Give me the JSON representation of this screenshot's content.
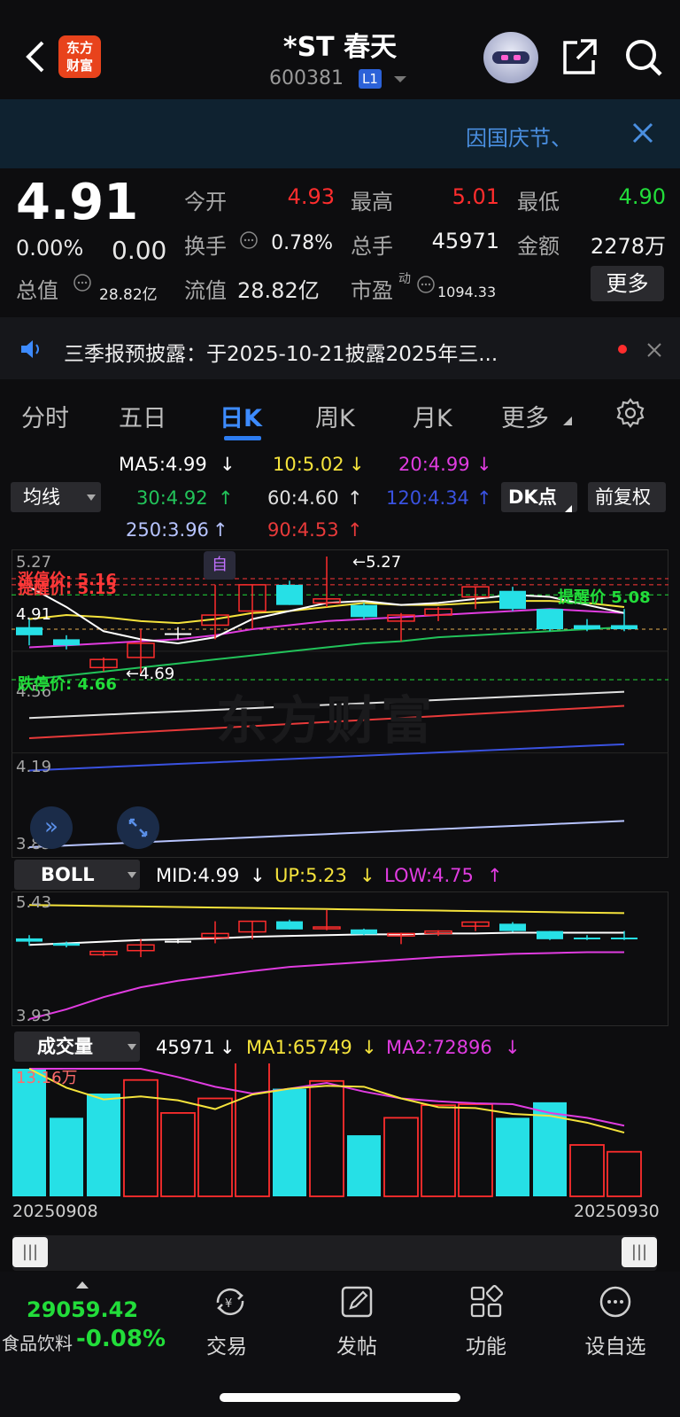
{
  "header": {
    "title": "*ST 春天",
    "code": "600381",
    "level_badge": "L1",
    "logo_text_1": "东方",
    "logo_text_2": "财富"
  },
  "banner": {
    "notice": "因国庆节、"
  },
  "quote": {
    "price": "4.91",
    "change_pct": "0.00%",
    "change": "0.00",
    "open_label": "今开",
    "open": "4.93",
    "high_label": "最高",
    "high": "5.01",
    "low_label": "最低",
    "low": "4.90",
    "turnover_label": "换手",
    "turnover": "0.78%",
    "volume_label": "总手",
    "volume": "45971",
    "amount_label": "金额",
    "amount": "2278万",
    "mktcap_label": "总值",
    "mktcap": "28.82亿",
    "float_label": "流值",
    "float": "28.82亿",
    "pe_label": "市盈",
    "pe_sup": "动",
    "pe": "1094.33",
    "more_label": "更多"
  },
  "news": {
    "text": "三季报预披露：于2025-10-21披露2025年三..."
  },
  "tabs": [
    "分时",
    "五日",
    "日K",
    "周K",
    "月K",
    "更多"
  ],
  "kline": {
    "selector": "均线",
    "ma5": "MA5:4.99",
    "ma10": "10:5.02",
    "ma20": "20:4.99",
    "ma30": "30:4.92",
    "ma60": "60:4.60",
    "ma120": "120:4.34",
    "ma250": "250:3.96",
    "ma90": "90:4.53",
    "dk_button": "DK点",
    "adjust_button": "前复权",
    "axis_top": "5.27",
    "axis_mid": "4.91",
    "axis_low": "4.56",
    "axis_4": "4.19",
    "axis_bottom": "3.83",
    "limit_up": "涨停价: 5.16",
    "alert_price_left": "提醒价: 5.13",
    "alert_price_right": "提醒价 5.08",
    "limit_down": "跌停价: 4.66",
    "max_marker": "←5.27",
    "min_marker": "←4.69",
    "self_badge": "自",
    "watermark": "东方财富"
  },
  "boll": {
    "selector": "BOLL",
    "mid": "MID:4.99",
    "up": "UP:5.23",
    "low": "LOW:4.75",
    "axis_top": "5.43",
    "axis_bottom": "3.93"
  },
  "volume": {
    "selector": "成交量",
    "value": "45971",
    "ma1": "MA1:65749",
    "ma2": "MA2:72896",
    "axis_top": "13.16万",
    "date_start": "20250908",
    "date_end": "20250930"
  },
  "bottom_nav": {
    "index_value": "29059.42",
    "index_name": "食品饮料",
    "index_change": "-0.08%",
    "trade": "交易",
    "post": "发帖",
    "function": "功能",
    "watchlist": "设自选"
  },
  "chart_data": {
    "type": "candlestick",
    "dates_start": "20250908",
    "dates_end": "20250930",
    "candles": [
      {
        "o": 4.92,
        "h": 4.96,
        "l": 4.83,
        "c": 4.88,
        "dir": "down"
      },
      {
        "o": 4.86,
        "h": 4.88,
        "l": 4.81,
        "c": 4.83,
        "dir": "down"
      },
      {
        "o": 4.72,
        "h": 4.77,
        "l": 4.7,
        "c": 4.76,
        "dir": "up"
      },
      {
        "o": 4.77,
        "h": 4.91,
        "l": 4.69,
        "c": 4.84,
        "dir": "up"
      },
      {
        "o": 4.89,
        "h": 4.92,
        "l": 4.86,
        "c": 4.89,
        "dir": "flat"
      },
      {
        "o": 4.93,
        "h": 5.13,
        "l": 4.86,
        "c": 4.98,
        "dir": "up"
      },
      {
        "o": 5.0,
        "h": 5.13,
        "l": 4.91,
        "c": 5.13,
        "dir": "up"
      },
      {
        "o": 5.13,
        "h": 5.15,
        "l": 5.03,
        "c": 5.03,
        "dir": "down"
      },
      {
        "o": 5.04,
        "h": 5.27,
        "l": 5.02,
        "c": 5.06,
        "dir": "up"
      },
      {
        "o": 5.03,
        "h": 5.04,
        "l": 4.96,
        "c": 4.97,
        "dir": "down"
      },
      {
        "o": 4.95,
        "h": 4.99,
        "l": 4.85,
        "c": 4.98,
        "dir": "up"
      },
      {
        "o": 4.98,
        "h": 5.02,
        "l": 4.95,
        "c": 5.01,
        "dir": "up"
      },
      {
        "o": 5.07,
        "h": 5.12,
        "l": 5.01,
        "c": 5.12,
        "dir": "up"
      },
      {
        "o": 5.1,
        "h": 5.12,
        "l": 5.0,
        "c": 5.01,
        "dir": "down"
      },
      {
        "o": 5.01,
        "h": 5.01,
        "l": 4.9,
        "c": 4.91,
        "dir": "down"
      },
      {
        "o": 4.93,
        "h": 4.96,
        "l": 4.9,
        "c": 4.91,
        "dir": "down"
      },
      {
        "o": 4.93,
        "h": 5.01,
        "l": 4.9,
        "c": 4.91,
        "dir": "down"
      }
    ],
    "volumes": [
      131600,
      81000,
      106000,
      120000,
      86000,
      101000,
      148000,
      111000,
      119000,
      63000,
      81000,
      94000,
      95000,
      81000,
      97000,
      53000,
      45971
    ],
    "volume_dir": [
      "down",
      "down",
      "down",
      "up",
      "up",
      "up",
      "up",
      "down",
      "up",
      "down",
      "up",
      "up",
      "up",
      "down",
      "down",
      "up",
      "up"
    ],
    "ylim": [
      3.83,
      5.27
    ]
  },
  "colors": {
    "up": "#ff2d2d",
    "down": "#26e0e6",
    "accent": "#3d8bff",
    "ma5": "#ffffff",
    "ma10": "#f5e33c",
    "ma20": "#e03ce0",
    "ma30": "#22c35a"
  }
}
